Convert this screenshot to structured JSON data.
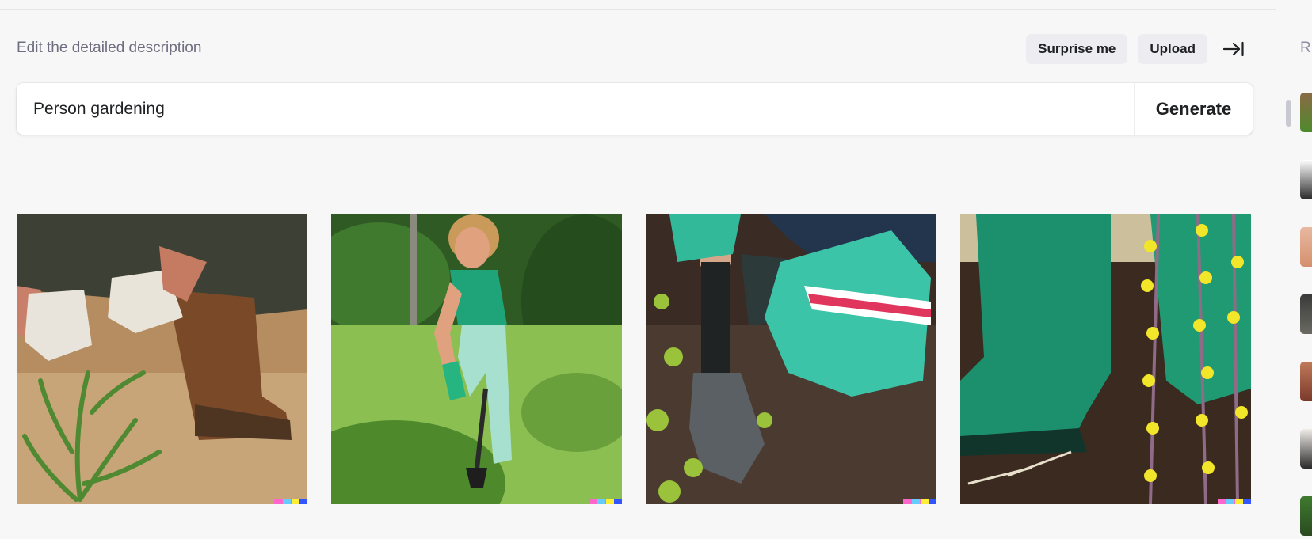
{
  "header": {
    "label": "Edit the detailed description",
    "surprise_label": "Surprise me",
    "upload_label": "Upload",
    "collapse_icon": "arrow-right-to-bar-icon"
  },
  "prompt": {
    "value": "Person gardening",
    "generate_label": "Generate"
  },
  "results": [
    {
      "subject": "Gloved hands pulling weeds beside a muddy brown rubber boot"
    },
    {
      "subject": "Smiling woman in green top and gloves digging with a shovel on a lawn"
    },
    {
      "subject": "Close-up of teal gloved hand pushing a spade into dark soil"
    },
    {
      "subject": "Green rubber boots in soil next to yellow flowering plants"
    }
  ],
  "sidebar": {
    "label": "R",
    "thumbnail_count": 7
  },
  "colors": {
    "background": "#f7f7f8",
    "pill": "#ececf1",
    "text": "#202123",
    "muted": "#6e6e80"
  }
}
